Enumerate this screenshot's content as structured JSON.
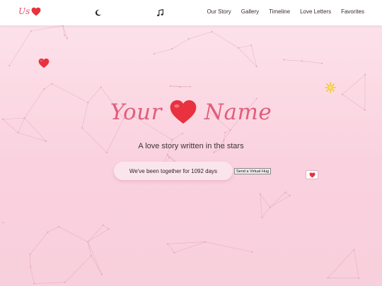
{
  "nav": {
    "logo_text": "Us",
    "logo_icon": "heart-icon",
    "theme_toggle_icon": "moon-icon",
    "music_toggle_icon": "music-note-icon",
    "links": [
      "Our Story",
      "Gallery",
      "Timeline",
      "Love Letters",
      "Favorites"
    ]
  },
  "hero": {
    "title_left": "Your",
    "title_icon": "heart-icon",
    "title_right": "Name",
    "tagline": "A love story written in the stars",
    "together_text": "We've been together for 1092 days",
    "hug_button": "Send a Virtual Hug"
  },
  "decorations": {
    "floating_heart_icon": "heart-icon",
    "sparkle_icon": "sparkle-icon",
    "mini_heart_icon": "heart-icon"
  },
  "colors": {
    "accent": "#e05e7c",
    "heart": "#e8323f",
    "background": "#fad1de",
    "constellation_lines": "#d79ab0",
    "nav_background": "#ffffff"
  }
}
